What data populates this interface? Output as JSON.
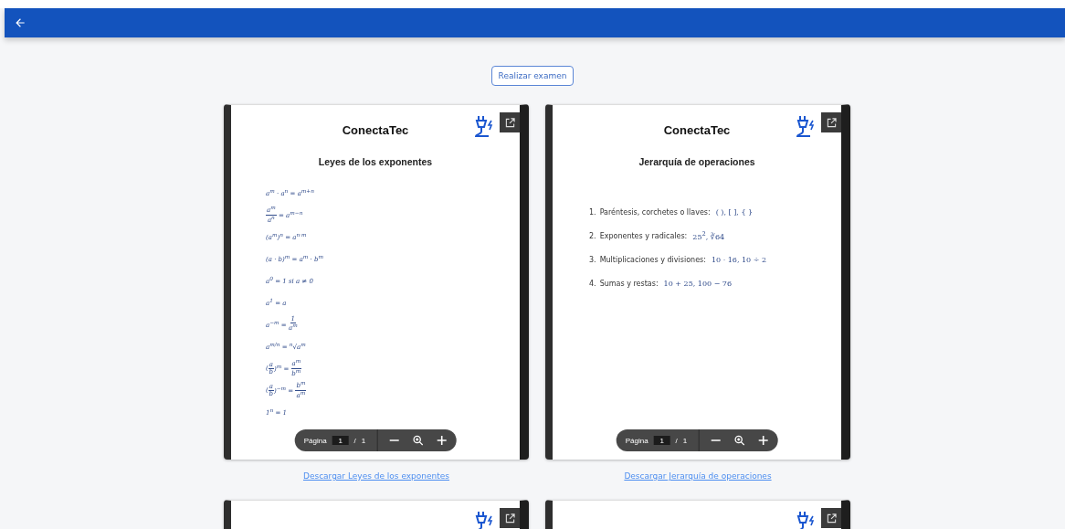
{
  "exam_button": "Realizar examen",
  "documents": [
    {
      "brand": "ConectaTec",
      "title": "Leyes de los exponentes",
      "kind": "formulas",
      "formulas": [
        [
          {
            "kind": "text",
            "s": "a$^{m}$ · a$^{n}$ = a$^{m+n}$"
          }
        ],
        [
          {
            "kind": "frac",
            "num": "a$^{m}$",
            "den": "a$^{n}$"
          },
          {
            "kind": "text",
            "s": " = a$^{m−n}$"
          }
        ],
        [
          {
            "kind": "text",
            "s": "(a$^{m}$)$^{n}$ = a$^{n·m}$"
          }
        ],
        [
          {
            "kind": "text",
            "s": "(a · b)$^{m}$ = a$^{m}$ · b$^{m}$"
          }
        ],
        [
          {
            "kind": "text",
            "s": "a$^{0}$ = 1 *si* a ≠ 0"
          }
        ],
        [
          {
            "kind": "text",
            "s": "a$^{1}$ = a"
          }
        ],
        [
          {
            "kind": "text",
            "s": "a$^{−m}$ = "
          },
          {
            "kind": "frac",
            "num": "1",
            "den": "a$^{m}$"
          }
        ],
        [
          {
            "kind": "text",
            "s": "a$^{m/n}$ = $^{n}$√a$^{m}$"
          }
        ],
        [
          {
            "kind": "text",
            "s": "("
          },
          {
            "kind": "frac",
            "num": "a",
            "den": "b"
          },
          {
            "kind": "text",
            "s": ")$^{m}$ = "
          },
          {
            "kind": "frac",
            "num": "a$^{m}$",
            "den": "b$^{m}$"
          }
        ],
        [
          {
            "kind": "text",
            "s": "("
          },
          {
            "kind": "frac",
            "num": "a",
            "den": "b"
          },
          {
            "kind": "text",
            "s": ")$^{−m}$ = "
          },
          {
            "kind": "frac",
            "num": "b$^{m}$",
            "den": "a$^{m}$"
          }
        ],
        [
          {
            "kind": "text",
            "s": "1$^{n}$ = 1"
          }
        ]
      ],
      "toolbar": {
        "page_label": "Página",
        "page": "1",
        "separator": "/",
        "total": "1"
      },
      "download": "Descargar Leyes de los exponentes"
    },
    {
      "brand": "ConectaTec",
      "title": "Jerarquía de operaciones",
      "kind": "list",
      "items": [
        {
          "number": "1.",
          "label": "Paréntesis, corchetes o llaves:",
          "math": "( ), [ ], { }"
        },
        {
          "number": "2.",
          "label": "Exponentes y radicales:",
          "math": "25$^{2}$, ∛64"
        },
        {
          "number": "3.",
          "label": "Multiplicaciones y divisiones:",
          "math": "10 · 16, 10 ÷ 2"
        },
        {
          "number": "4.",
          "label": "Sumas y restas:",
          "math": "10 + 25, 100 − 76"
        }
      ],
      "toolbar": {
        "page_label": "Página",
        "page": "1",
        "separator": "/",
        "total": "1"
      },
      "download": "Descargar Jerarquía de operaciones"
    },
    {
      "kind": "cut"
    },
    {
      "kind": "cut"
    }
  ]
}
